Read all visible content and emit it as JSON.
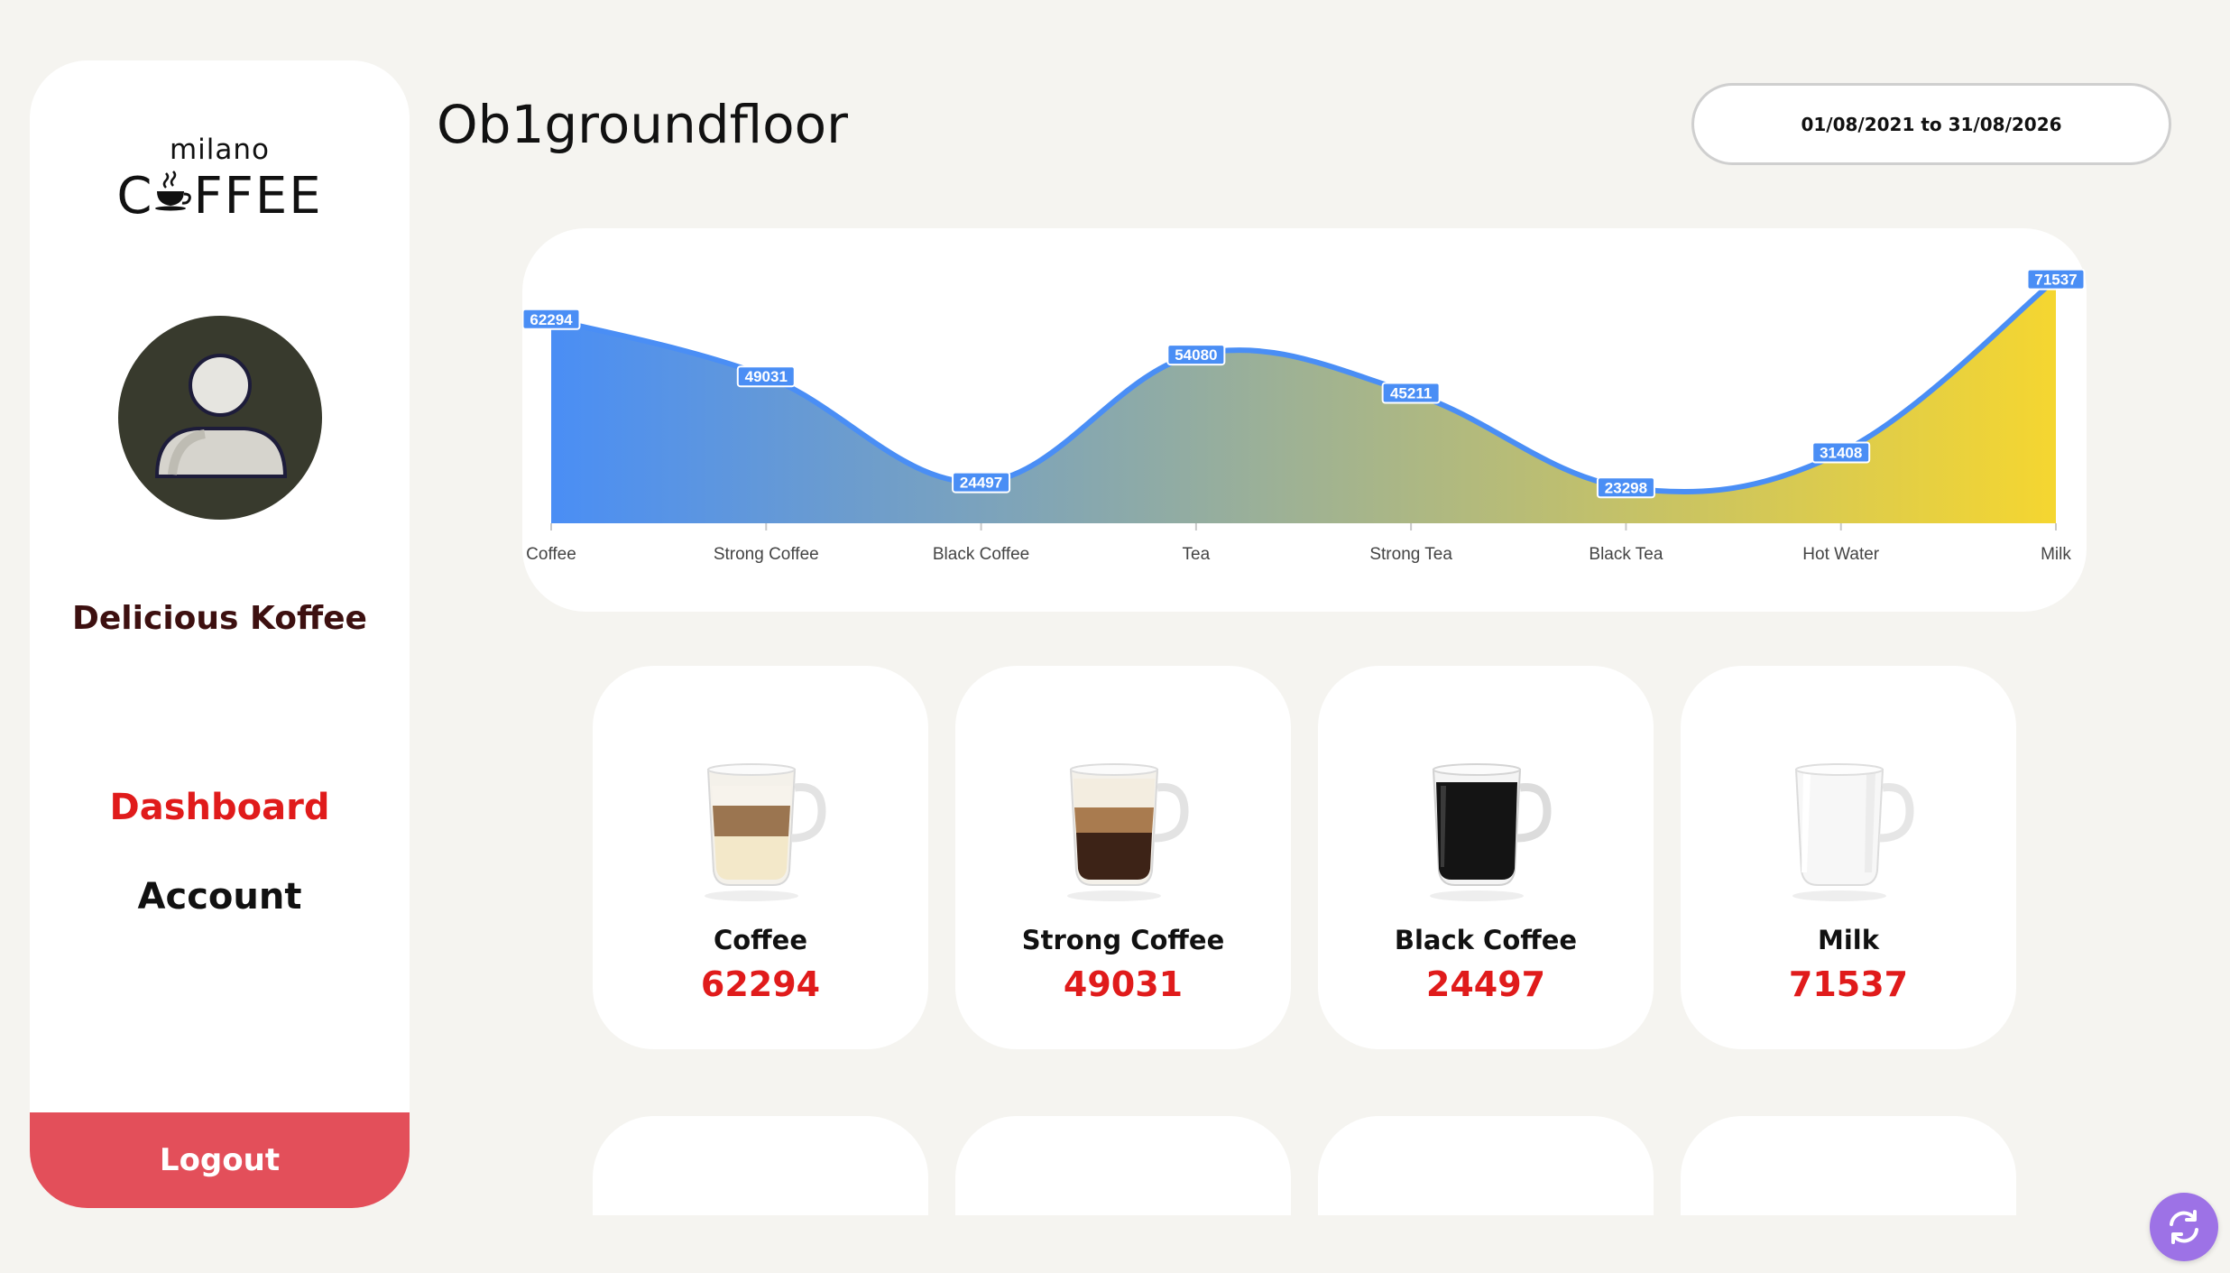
{
  "sidebar": {
    "logo_top": "milano",
    "logo_main_prefix": "C",
    "logo_main_suffix": "FFEE",
    "user_name": "Delicious Koffee",
    "nav": [
      {
        "label": "Dashboard",
        "active": true
      },
      {
        "label": "Account",
        "active": false
      }
    ],
    "logout_label": "Logout"
  },
  "header": {
    "title": "Ob1groundfloor",
    "date_range": "01/08/2021 to 31/08/2026"
  },
  "chart_data": {
    "type": "area",
    "categories": [
      "Coffee",
      "Strong Coffee",
      "Black Coffee",
      "Tea",
      "Strong Tea",
      "Black Tea",
      "Hot Water",
      "Milk"
    ],
    "values": [
      62294,
      49031,
      24497,
      54080,
      45211,
      23298,
      31408,
      71537
    ],
    "ylim": [
      15000,
      75000
    ],
    "grid": false,
    "fill_gradient": [
      "#4a8ef5",
      "#f5d630"
    ],
    "line_color": "#4a8ef5"
  },
  "products": [
    {
      "name": "Coffee",
      "value": "62294",
      "icon": "latte-cup-icon"
    },
    {
      "name": "Strong Coffee",
      "value": "49031",
      "icon": "cappuccino-cup-icon"
    },
    {
      "name": "Black Coffee",
      "value": "24497",
      "icon": "black-coffee-cup-icon"
    },
    {
      "name": "Milk",
      "value": "71537",
      "icon": "milk-cup-icon"
    }
  ],
  "colors": {
    "accent_red": "#e01b1b",
    "logout_bg": "#e34f5a",
    "refresh_bg": "#9d72e6"
  },
  "refresh_icon": "refresh-icon"
}
